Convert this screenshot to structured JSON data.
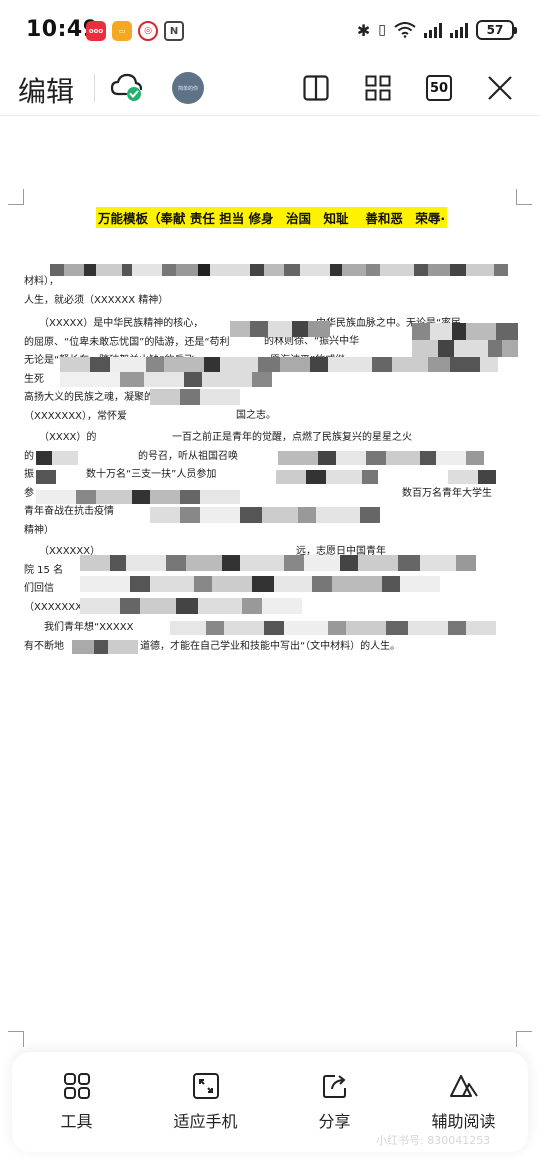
{
  "status_bar": {
    "time": "10:49",
    "battery": "57",
    "app_badges": [
      "app-red-icon",
      "app-yellow-icon",
      "app-circle-icon",
      "nfc-icon"
    ]
  },
  "toolbar": {
    "edit_label": "编辑",
    "avatar_text": "简单的你",
    "zoom_level": "50",
    "icons": [
      "cloud-synced-icon",
      "split-view-icon",
      "grid-icon",
      "close-icon"
    ]
  },
  "document": {
    "title": "万能模板（奉献 责任 担当 修身　治国　知耻　 善和恶　荣辱·",
    "paragraphs": [
      [
        "材料），",
        "人生，就必须（XXXXXX 精神）"
      ],
      [
        "　　（XXXXX）是中华民族精神的核心，",
        "的屈原、“位卑未敢忘忧国”的陆游，还是“苟利",
        "无论是“驽长车，踏破贺兰山缺”的岳飞",
        "生死",
        "高扬大义的民族之魂，凝聚的是同心同德",
        "（XXXXXXX），常怀爱"
      ],
      [
        "　　（XXXX）的",
        "的",
        "振",
        "参",
        "青年奋战在抗击疫情",
        "精神）"
      ],
      [
        "　　（XXXXXX）",
        "院 15 名",
        "们回信",
        "（XXXXXXXXX）精神"
      ],
      [
        "　　我们青年想“XXXXX",
        "有不断地"
      ]
    ],
    "fragments": {
      "p1_mid": "中华民族血脉之中。无论是“率民",
      "p1_mid2": "的林则徐、“振兴中华",
      "p1_mid3": "愿海波平”的戚继",
      "p1_mid4": "国之志。",
      "p2_mid": "一百之前正是青年的觉醒，点燃了民族复兴的星星之火",
      "p2_mid2": "的号召，听从祖国召唤",
      "p2_mid3": "数十万名“三支一扶”人员参加",
      "p2_mid4": "数百万名青年大学生",
      "p3_mid": "远，志愿日中国青年",
      "p4_mid": "道德，才能在自己学业和技能中写出“（文中材料）的人生。"
    }
  },
  "bottom_bar": {
    "items": [
      {
        "label": "工具",
        "icon": "tools-grid-icon"
      },
      {
        "label": "适应手机",
        "icon": "fit-screen-icon"
      },
      {
        "label": "分享",
        "icon": "share-icon"
      },
      {
        "label": "辅助阅读",
        "icon": "assist-read-icon"
      }
    ]
  },
  "watermark": "小红书号: 830041253"
}
